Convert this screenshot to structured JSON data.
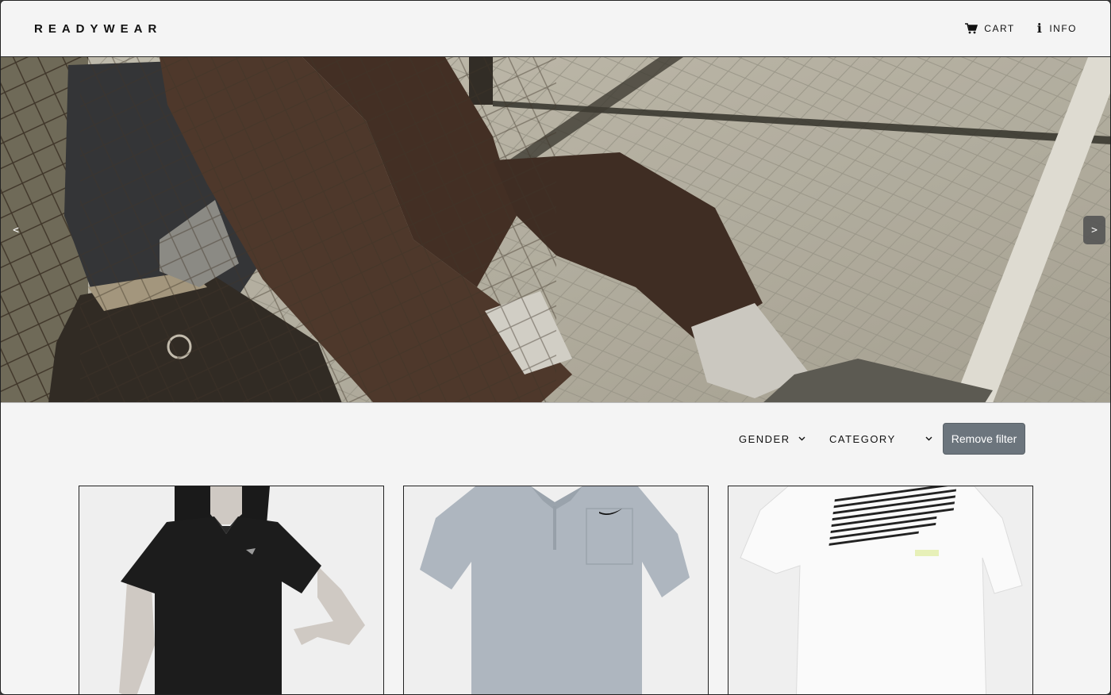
{
  "header": {
    "logo": "READYWEAR",
    "nav": [
      {
        "label": "CART",
        "icon": "cart-icon"
      },
      {
        "label": "INFO",
        "icon": "info-icon"
      }
    ]
  },
  "hero": {
    "prev_label": "<",
    "next_label": ">"
  },
  "filters": {
    "gender_label": "GENDER",
    "category_label": "CATEGORY",
    "remove_label": "Remove filter"
  },
  "colors": {
    "background": "#f4f4f4",
    "button": "#6c757d",
    "text": "#111111"
  }
}
